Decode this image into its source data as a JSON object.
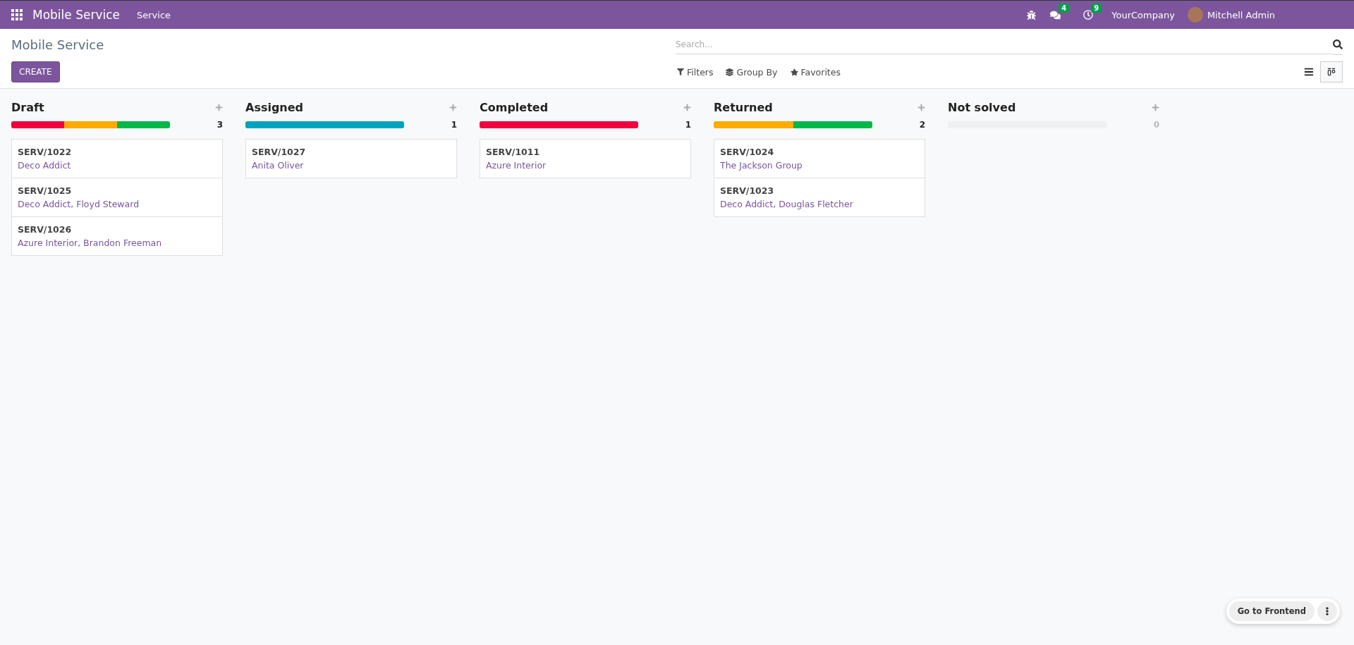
{
  "navbar": {
    "app_name": "Mobile Service",
    "menu": [
      "Service"
    ],
    "messages_count": "4",
    "activities_count": "9",
    "company": "YourCompany",
    "user": "Mitchell Admin"
  },
  "control_panel": {
    "title": "Mobile Service",
    "create_button": "CREATE",
    "search": {
      "placeholder": "Search..."
    },
    "search_options": [
      {
        "kind": "filter",
        "label": "Filters"
      },
      {
        "kind": "group",
        "label": "Group By"
      },
      {
        "kind": "favorite",
        "label": "Favorites"
      }
    ],
    "views": [
      {
        "kind": "list",
        "selected": false
      },
      {
        "kind": "kanban",
        "selected": true
      }
    ]
  },
  "columns": [
    {
      "title": "Draft",
      "count": "3",
      "progress": [
        {
          "color": "#f0003c"
        },
        {
          "color": "#ffac00"
        },
        {
          "color": "#00b74a"
        }
      ],
      "cards": [
        {
          "reference": "SERV/1022",
          "customer": "Deco Addict"
        },
        {
          "reference": "SERV/1025",
          "customer": "Deco Addict, Floyd Steward"
        },
        {
          "reference": "SERV/1026",
          "customer": "Azure Interior, Brandon Freeman"
        }
      ]
    },
    {
      "title": "Assigned",
      "count": "1",
      "progress": [
        {
          "color": "#00a3bf"
        }
      ],
      "cards": [
        {
          "reference": "SERV/1027",
          "customer": "Anita Oliver"
        }
      ]
    },
    {
      "title": "Completed",
      "count": "1",
      "progress": [
        {
          "color": "#f0003c"
        }
      ],
      "cards": [
        {
          "reference": "SERV/1011",
          "customer": "Azure Interior"
        }
      ]
    },
    {
      "title": "Returned",
      "count": "2",
      "progress": [
        {
          "color": "#ffac00"
        },
        {
          "color": "#00b74a"
        }
      ],
      "cards": [
        {
          "reference": "SERV/1024",
          "customer": "The Jackson Group"
        },
        {
          "reference": "SERV/1023",
          "customer": "Deco Addict, Douglas Fletcher"
        }
      ]
    },
    {
      "title": "Not solved",
      "count": "0"
    }
  ],
  "frontend_button": "Go to Frontend"
}
